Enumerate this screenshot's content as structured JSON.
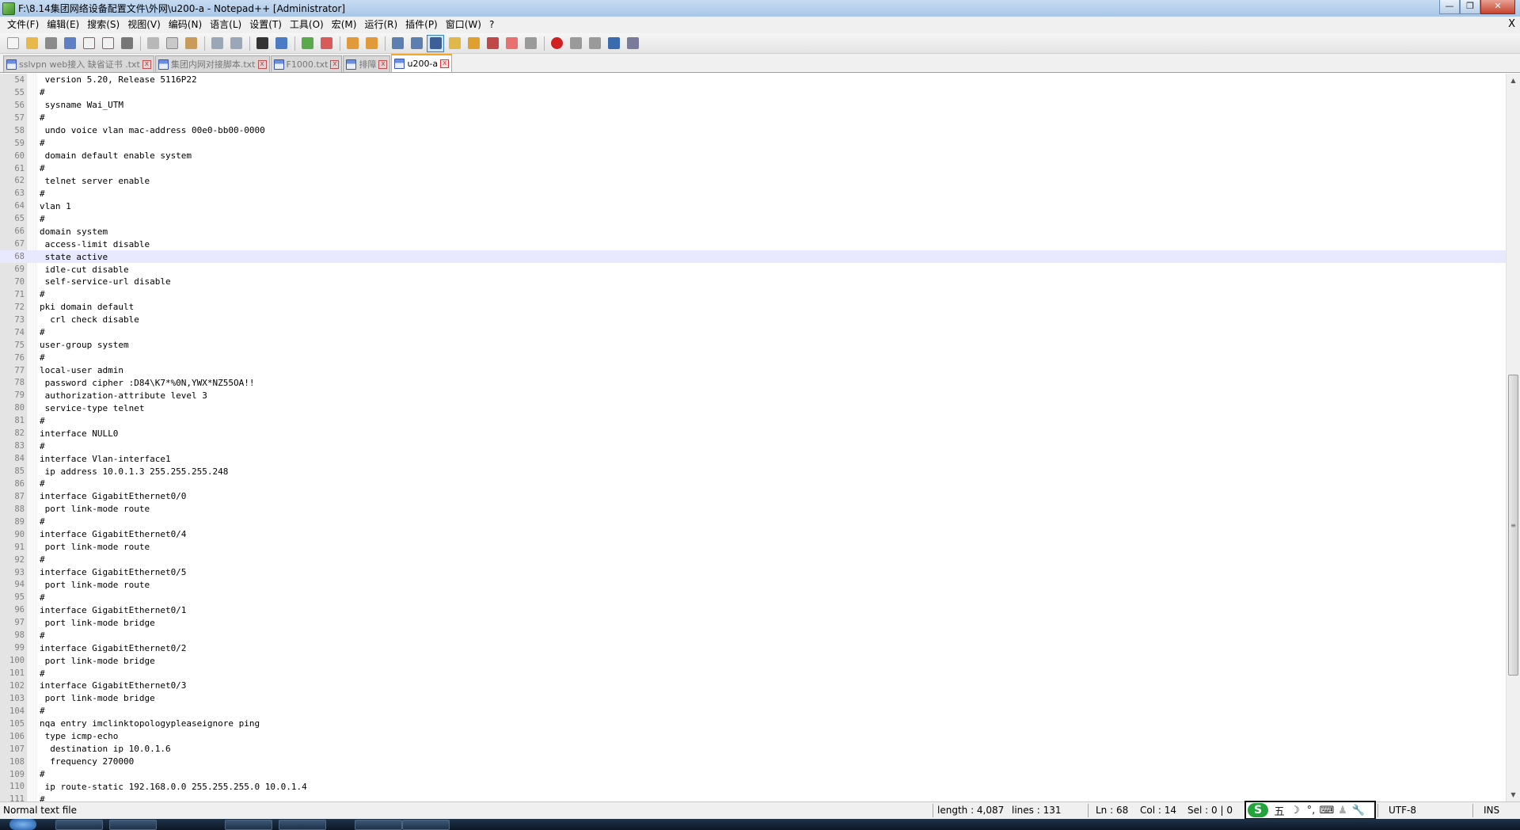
{
  "window": {
    "title": "F:\\8.14集团网络设备配置文件\\外网\\u200-a - Notepad++ [Administrator]",
    "buttons": {
      "minimize": "—",
      "maximize": "❐",
      "close": "✕"
    }
  },
  "menu": {
    "items": [
      "文件(F)",
      "编辑(E)",
      "搜索(S)",
      "视图(V)",
      "编码(N)",
      "语言(L)",
      "设置(T)",
      "工具(O)",
      "宏(M)",
      "运行(R)",
      "插件(P)",
      "窗口(W)",
      "?"
    ],
    "close_doc": "X"
  },
  "tabs": [
    {
      "label": "sslvpn web接入 缺省证书 .txt",
      "active": false
    },
    {
      "label": "集团内网对接脚本.txt",
      "active": false
    },
    {
      "label": "F1000.txt",
      "active": false
    },
    {
      "label": "排障",
      "active": false
    },
    {
      "label": "u200-a",
      "active": true
    }
  ],
  "editor": {
    "current_line": 68,
    "lines": [
      {
        "n": "54",
        "t": " version 5.20, Release 5116P22"
      },
      {
        "n": "55",
        "t": "#"
      },
      {
        "n": "56",
        "t": " sysname Wai_UTM"
      },
      {
        "n": "57",
        "t": "#"
      },
      {
        "n": "58",
        "t": " undo voice vlan mac-address 00e0-bb00-0000"
      },
      {
        "n": "59",
        "t": "#"
      },
      {
        "n": "60",
        "t": " domain default enable system"
      },
      {
        "n": "61",
        "t": "#"
      },
      {
        "n": "62",
        "t": " telnet server enable"
      },
      {
        "n": "63",
        "t": "#"
      },
      {
        "n": "64",
        "t": "vlan 1"
      },
      {
        "n": "65",
        "t": "#"
      },
      {
        "n": "66",
        "t": "domain system"
      },
      {
        "n": "67",
        "t": " access-limit disable"
      },
      {
        "n": "68",
        "t": " state active"
      },
      {
        "n": "69",
        "t": " idle-cut disable"
      },
      {
        "n": "70",
        "t": " self-service-url disable"
      },
      {
        "n": "71",
        "t": "#"
      },
      {
        "n": "72",
        "t": "pki domain default"
      },
      {
        "n": "73",
        "t": "  crl check disable"
      },
      {
        "n": "74",
        "t": "#"
      },
      {
        "n": "75",
        "t": "user-group system"
      },
      {
        "n": "76",
        "t": "#"
      },
      {
        "n": "77",
        "t": "local-user admin"
      },
      {
        "n": "78",
        "t": " password cipher :D84\\K7*%0N,YWX*NZ55OA!!"
      },
      {
        "n": "79",
        "t": " authorization-attribute level 3"
      },
      {
        "n": "80",
        "t": " service-type telnet"
      },
      {
        "n": "81",
        "t": "#"
      },
      {
        "n": "82",
        "t": "interface NULL0"
      },
      {
        "n": "83",
        "t": "#"
      },
      {
        "n": "84",
        "t": "interface Vlan-interface1"
      },
      {
        "n": "85",
        "t": " ip address 10.0.1.3 255.255.255.248"
      },
      {
        "n": "86",
        "t": "#"
      },
      {
        "n": "87",
        "t": "interface GigabitEthernet0/0"
      },
      {
        "n": "88",
        "t": " port link-mode route"
      },
      {
        "n": "89",
        "t": "#"
      },
      {
        "n": "90",
        "t": "interface GigabitEthernet0/4"
      },
      {
        "n": "91",
        "t": " port link-mode route"
      },
      {
        "n": "92",
        "t": "#"
      },
      {
        "n": "93",
        "t": "interface GigabitEthernet0/5"
      },
      {
        "n": "94",
        "t": " port link-mode route"
      },
      {
        "n": "95",
        "t": "#"
      },
      {
        "n": "96",
        "t": "interface GigabitEthernet0/1"
      },
      {
        "n": "97",
        "t": " port link-mode bridge"
      },
      {
        "n": "98",
        "t": "#"
      },
      {
        "n": "99",
        "t": "interface GigabitEthernet0/2"
      },
      {
        "n": "100",
        "t": " port link-mode bridge"
      },
      {
        "n": "101",
        "t": "#"
      },
      {
        "n": "102",
        "t": "interface GigabitEthernet0/3"
      },
      {
        "n": "103",
        "t": " port link-mode bridge"
      },
      {
        "n": "104",
        "t": "#"
      },
      {
        "n": "105",
        "t": "nqa entry imclinktopologypleaseignore ping"
      },
      {
        "n": "106",
        "t": " type icmp-echo"
      },
      {
        "n": "107",
        "t": "  destination ip 10.0.1.6"
      },
      {
        "n": "108",
        "t": "  frequency 270000"
      },
      {
        "n": "109",
        "t": "#"
      },
      {
        "n": "110",
        "t": " ip route-static 192.168.0.0 255.255.255.0 10.0.1.4"
      },
      {
        "n": "111",
        "t": "#"
      }
    ]
  },
  "statusbar": {
    "filetype": "Normal text file",
    "length": "length : 4,087",
    "lines": "lines : 131",
    "ln": "Ln : 68",
    "col": "Col : 14",
    "sel": "Sel : 0 | 0",
    "encoding": "UTF-8",
    "mode": "INS"
  },
  "ime": {
    "logo": "S",
    "items": [
      "五",
      "☽",
      "°,",
      "⌨",
      "♟",
      "🔧"
    ]
  },
  "colors": {
    "current_line": "#e8e8ff",
    "gutter": "#e4e4e4",
    "active_tab_accent": "#f5a623"
  }
}
